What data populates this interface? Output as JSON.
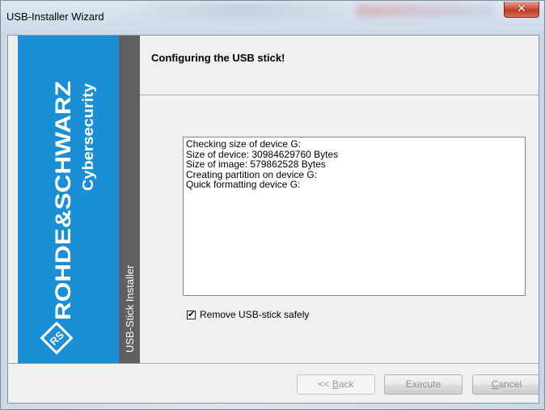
{
  "window": {
    "title": "USB-Installer Wizard",
    "close_glyph": "✕"
  },
  "brand": {
    "company": "ROHDE&SCHWARZ",
    "division": "Cybersecurity",
    "logo_icon": "rs-diamond-logo",
    "logo_text": "RS",
    "accent_color": "#1a8fd6"
  },
  "side_strip": {
    "label": "USB-Stick Installer"
  },
  "header": {
    "title": "Configuring the USB stick!"
  },
  "log": {
    "lines": [
      "Checking size of device G:",
      "Size of device: 30984629760 Bytes",
      "Size of image: 579862528 Bytes",
      "Creating partition on device G:",
      "Quick formatting device G:"
    ]
  },
  "options": {
    "remove_safely": {
      "label": "Remove USB-stick safely",
      "checked": true,
      "check_glyph": "✔"
    }
  },
  "buttons": {
    "back": {
      "prefix": "<< ",
      "mnemonic": "B",
      "rest": "ack",
      "enabled": false
    },
    "execute": {
      "label": "Execute",
      "enabled": true
    },
    "cancel": {
      "mnemonic": "C",
      "rest": "ancel",
      "enabled": true
    }
  }
}
